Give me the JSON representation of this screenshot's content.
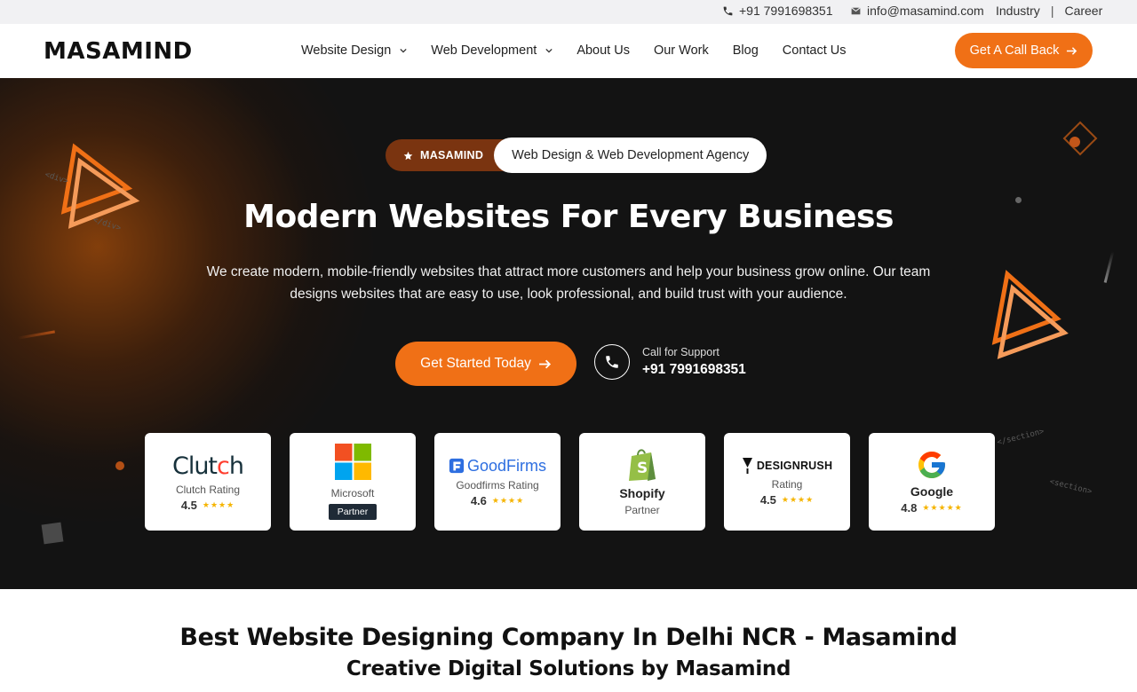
{
  "topbar": {
    "phone": "+91 7991698351",
    "email": "info@masamind.com",
    "links": [
      "Industry",
      "Career"
    ],
    "separator": "|"
  },
  "brand": {
    "logo_text": "MASAMIND",
    "accent_color": "#f07016"
  },
  "nav": {
    "items": [
      {
        "label": "Website Design",
        "has_dropdown": true
      },
      {
        "label": "Web Development",
        "has_dropdown": true
      },
      {
        "label": "About Us",
        "has_dropdown": false
      },
      {
        "label": "Our Work",
        "has_dropdown": false
      },
      {
        "label": "Blog",
        "has_dropdown": false
      },
      {
        "label": "Contact Us",
        "has_dropdown": false
      }
    ],
    "cta_label": "Get A Call Back"
  },
  "hero": {
    "badge_left": "MASAMIND",
    "badge_right": "Web Design & Web Development Agency",
    "title": "Modern Websites For Every Business",
    "description_line1": "We create modern, mobile-friendly websites that attract more customers and help your business grow online. Our team",
    "description_line2": "designs websites that are easy to use, look professional, and build trust with your audience.",
    "primary_button": "Get Started Today",
    "support_label": "Call for Support",
    "support_number": "+91 7991698351",
    "decor_code_tags": [
      "<div>",
      "</div>",
      "</section>",
      "<section>"
    ]
  },
  "ratings": [
    {
      "brand": "Clutch",
      "label": "Clutch Rating",
      "value": "4.5",
      "stars": "★★★★"
    },
    {
      "brand": "Microsoft",
      "label": "Microsoft",
      "chip": "Partner"
    },
    {
      "brand": "GoodFirms",
      "label": "Goodfirms Rating",
      "value": "4.6",
      "stars": "★★★★"
    },
    {
      "brand": "Shopify",
      "label": "Partner"
    },
    {
      "brand": "DESIGNRUSH",
      "label": "Rating",
      "value": "4.5",
      "stars": "★★★★"
    },
    {
      "brand": "Google",
      "value": "4.8",
      "stars": "★★★★★"
    }
  ],
  "section": {
    "title": "Best Website Designing Company In Delhi NCR - Masamind",
    "subtitle": "Creative Digital Solutions by Masamind"
  }
}
